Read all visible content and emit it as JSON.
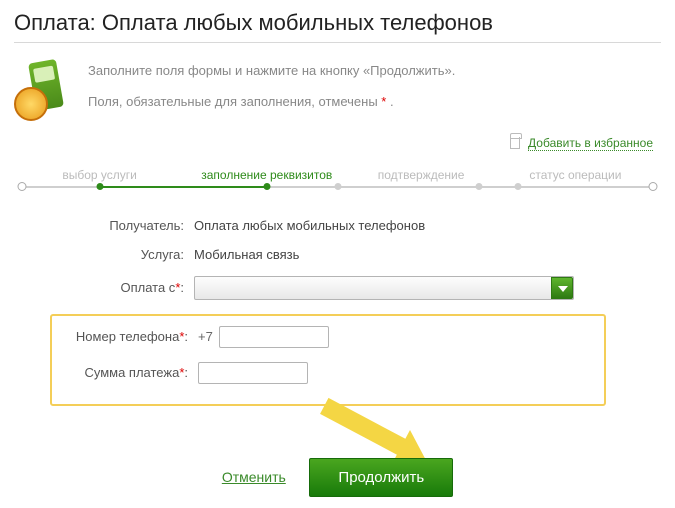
{
  "title": "Оплата: Оплата любых мобильных телефонов",
  "intro": {
    "line1": "Заполните поля формы и нажмите на кнопку «Продолжить».",
    "line2_pre": "Поля, обязательные для заполнения, отмечены ",
    "line2_ast": "*",
    "line2_post": " ."
  },
  "favorites": {
    "label": "Добавить в избранное"
  },
  "steps": {
    "s1": "выбор услуги",
    "s2": "заполнение реквизитов",
    "s3": "подтверждение",
    "s4": "статус операции"
  },
  "form": {
    "recipient": {
      "label": "Получатель:",
      "value": "Оплата любых мобильных телефонов"
    },
    "service": {
      "label": "Услуга:",
      "value": "Мобильная связь"
    },
    "pay_from": {
      "label": "Оплата с"
    },
    "phone": {
      "label": "Номер телефона",
      "prefix": "+7"
    },
    "amount": {
      "label": "Сумма платежа"
    }
  },
  "actions": {
    "cancel": "Отменить",
    "next": "Продолжить"
  }
}
